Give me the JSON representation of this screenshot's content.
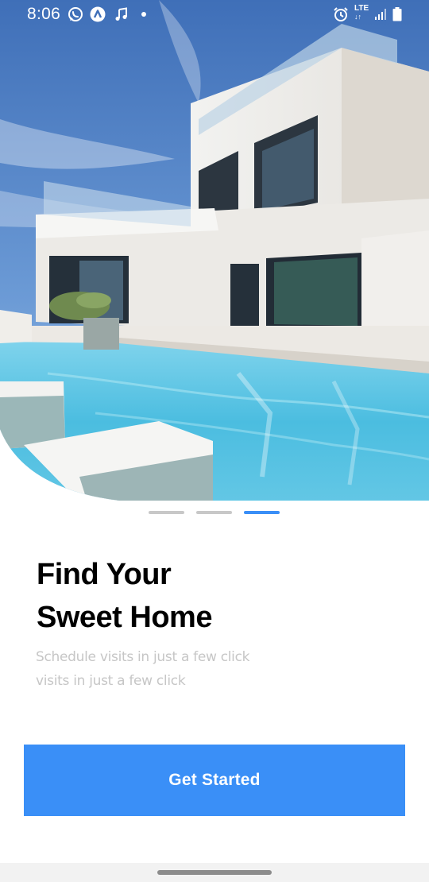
{
  "status_bar": {
    "time": "8:06",
    "network_type": "LTE",
    "network_arrows": "↓↑",
    "icons": [
      "whatsapp-icon",
      "app-notification-icon",
      "music-note-icon",
      "more-notifications-dot-icon",
      "alarm-icon",
      "signal-icon",
      "battery-icon"
    ]
  },
  "hero": {
    "image_subject": "modern white villa with swimming pool"
  },
  "onboarding": {
    "page_count": 3,
    "active_page": 3,
    "title_line1": "Find Your",
    "title_line2": "Sweet Home",
    "subtitle_line1": "Schedule visits in just a few click",
    "subtitle_line2": "visits in just a few click"
  },
  "actions": {
    "get_started_label": "Get Started"
  },
  "colors": {
    "accent": "#3a8ff7",
    "indicator_inactive": "#c8c8c8",
    "indicator_active": "#3a8ff7",
    "subtitle_text": "#c6c6c6"
  }
}
